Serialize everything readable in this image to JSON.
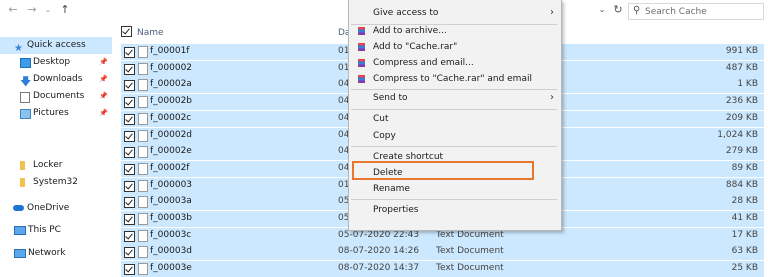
{
  "search": {
    "placeholder": "Search Cache"
  },
  "nav": {
    "quick_access": "Quick access",
    "desktop": "Desktop",
    "downloads": "Downloads",
    "documents": "Documents",
    "pictures": "Pictures",
    "locker": "Locker",
    "system32": "System32",
    "onedrive": "OneDrive",
    "this_pc": "This PC",
    "network": "Network"
  },
  "list": {
    "columns": {
      "name": "Name",
      "date": "Da"
    },
    "rows": [
      {
        "name": "f_00001f",
        "date": "01",
        "type": "",
        "size": "991 KB"
      },
      {
        "name": "f_000002",
        "date": "01",
        "type": "",
        "size": "487 KB"
      },
      {
        "name": "f_00002a",
        "date": "04",
        "type": "",
        "size": "1 KB"
      },
      {
        "name": "f_00002b",
        "date": "04",
        "type": "",
        "size": "236 KB"
      },
      {
        "name": "f_00002c",
        "date": "04",
        "type": "",
        "size": "209 KB"
      },
      {
        "name": "f_00002d",
        "date": "04",
        "type": "",
        "size": "1,024 KB"
      },
      {
        "name": "f_00002e",
        "date": "04",
        "type": "",
        "size": "279 KB"
      },
      {
        "name": "f_00002f",
        "date": "04",
        "type": "",
        "size": "89 KB"
      },
      {
        "name": "f_000003",
        "date": "01",
        "type": "",
        "size": "884 KB"
      },
      {
        "name": "f_00003a",
        "date": "05",
        "type": "",
        "size": "28 KB"
      },
      {
        "name": "f_00003b",
        "date": "05",
        "type": "",
        "size": "41 KB"
      },
      {
        "name": "f_00003c",
        "date": "05-07-2020 22:43",
        "type": "Text Document",
        "size": "17 KB"
      },
      {
        "name": "f_00003d",
        "date": "08-07-2020 14:26",
        "type": "Text Document",
        "size": "63 KB"
      },
      {
        "name": "f_00003e",
        "date": "08-07-2020 14:37",
        "type": "Text Document",
        "size": "25 KB"
      }
    ]
  },
  "context_menu": {
    "give_access": "Give access to",
    "add_archive": "Add to archive...",
    "add_rar": "Add to \"Cache.rar\"",
    "compress_email": "Compress and email...",
    "compress_rar_email": "Compress to \"Cache.rar\" and email",
    "send_to": "Send to",
    "cut": "Cut",
    "copy": "Copy",
    "create_shortcut": "Create shortcut",
    "delete": "Delete",
    "rename": "Rename",
    "properties": "Properties"
  }
}
